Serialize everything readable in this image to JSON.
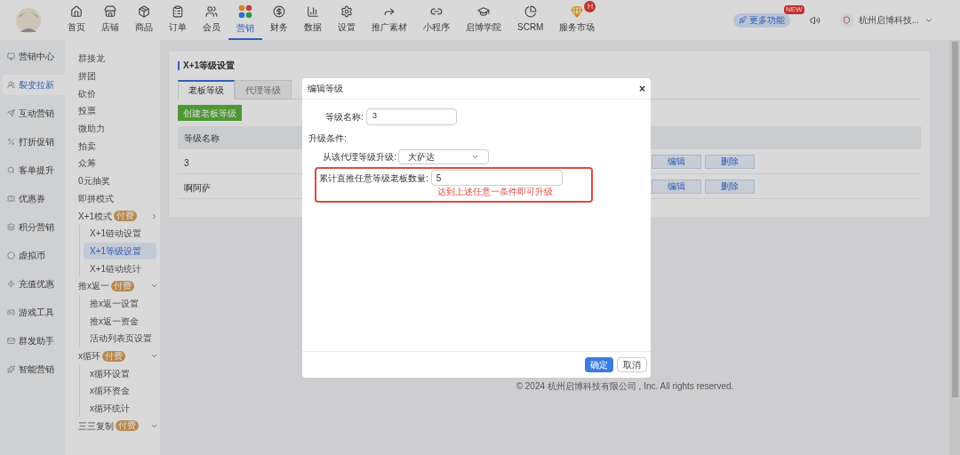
{
  "top_nav": {
    "items": [
      {
        "label": "首页",
        "selected": false
      },
      {
        "label": "店铺",
        "selected": false
      },
      {
        "label": "商品",
        "selected": false
      },
      {
        "label": "订单",
        "selected": false
      },
      {
        "label": "会员",
        "selected": false
      },
      {
        "label": "营销",
        "selected": true
      },
      {
        "label": "财务",
        "selected": false
      },
      {
        "label": "数据",
        "selected": false
      },
      {
        "label": "设置",
        "selected": false
      },
      {
        "label": "推广素材",
        "selected": false
      },
      {
        "label": "小程序",
        "selected": false
      },
      {
        "label": "启博学院",
        "selected": false
      },
      {
        "label": "SCRM",
        "selected": false
      },
      {
        "label": "服务市场",
        "selected": false,
        "badge": "H"
      }
    ],
    "more_button": {
      "label": "更多功能",
      "badge": "NEW"
    },
    "account": {
      "name": "杭州启博科技..."
    }
  },
  "sidebar": {
    "items": [
      {
        "label": "营销中心",
        "selected": false
      },
      {
        "label": "裂变拉新",
        "selected": true
      },
      {
        "label": "互动营销",
        "selected": false
      },
      {
        "label": "打折促销",
        "selected": false
      },
      {
        "label": "客单提升",
        "selected": false
      },
      {
        "label": "优惠券",
        "selected": false
      },
      {
        "label": "积分营销",
        "selected": false
      },
      {
        "label": "虚拟币",
        "selected": false
      },
      {
        "label": "充值优惠",
        "selected": false
      },
      {
        "label": "游戏工具",
        "selected": false
      },
      {
        "label": "群发助手",
        "selected": false
      },
      {
        "label": "智能营销",
        "selected": false
      }
    ]
  },
  "submenu": {
    "items": [
      {
        "kind": "item",
        "label": "群接龙",
        "selected": false
      },
      {
        "kind": "item",
        "label": "拼团",
        "selected": false
      },
      {
        "kind": "item",
        "label": "砍价",
        "selected": false
      },
      {
        "kind": "item",
        "label": "投票",
        "selected": false
      },
      {
        "kind": "item",
        "label": "微助力",
        "selected": false
      },
      {
        "kind": "item",
        "label": "拍卖",
        "selected": false
      },
      {
        "kind": "item",
        "label": "众筹",
        "selected": false
      },
      {
        "kind": "item",
        "label": "0元抽奖",
        "selected": false
      },
      {
        "kind": "item",
        "label": "即拼模式",
        "selected": false
      },
      {
        "kind": "group",
        "label": "X+1模式",
        "tag": "付费",
        "expanded": false,
        "children": [
          {
            "label": "X+1链动设置",
            "selected": false
          },
          {
            "label": "X+1等级设置",
            "selected": true
          },
          {
            "label": "X+1链动统计",
            "selected": false
          }
        ]
      },
      {
        "kind": "group",
        "label": "推x返一",
        "tag": "付费",
        "expanded": true,
        "children": [
          {
            "label": "推x返一设置",
            "selected": false
          },
          {
            "label": "推x返一资金",
            "selected": false
          },
          {
            "label": "活动列表页设置",
            "selected": false
          }
        ]
      },
      {
        "kind": "group",
        "label": "x循环",
        "tag": "付费",
        "expanded": true,
        "children": [
          {
            "label": "x循环设置",
            "selected": false
          },
          {
            "label": "x循环资金",
            "selected": false
          },
          {
            "label": "x循环统计",
            "selected": false
          }
        ]
      },
      {
        "kind": "group",
        "label": "三三复制",
        "tag": "付费",
        "expanded": true
      }
    ]
  },
  "page": {
    "title": "X+1等级设置",
    "tabs": [
      {
        "label": "老板等级",
        "selected": true
      },
      {
        "label": "代理等级",
        "selected": false
      }
    ],
    "create_button": "创建老板等级",
    "table": {
      "columns": [
        "等级名称"
      ],
      "rows": [
        {
          "cells": [
            "3"
          ],
          "actions": [
            "编辑",
            "删除"
          ]
        },
        {
          "cells": [
            "啊阿萨"
          ],
          "actions": [
            "编辑",
            "删除"
          ]
        }
      ]
    },
    "footer": "© 2024 杭州启博科技有限公司 , Inc. All rights reserved."
  },
  "dialog": {
    "title": "编辑等级",
    "close": "×",
    "name_field": {
      "label": "等级名称:",
      "value": "3"
    },
    "section": "升级条件:",
    "select_field": {
      "label": "从该代理等级升级:",
      "value": "大萨达"
    },
    "count_field": {
      "label": "累计直推任意等级老板数量:",
      "value": "5",
      "highlighted": true
    },
    "hint": "达到上述任意一条件即可升级",
    "buttons": [
      {
        "label": "确定",
        "kind": "primary"
      },
      {
        "label": "取消",
        "kind": "default"
      }
    ]
  }
}
